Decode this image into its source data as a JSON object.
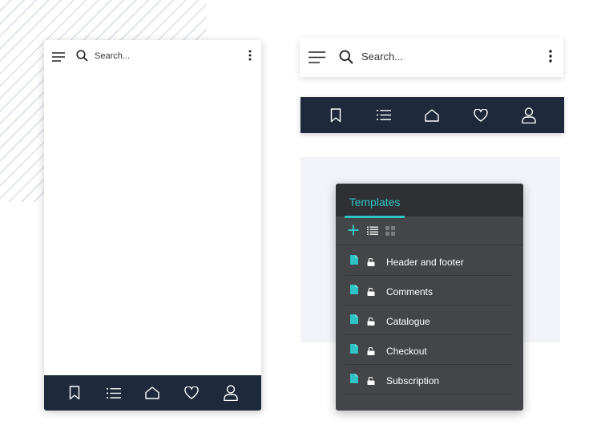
{
  "phone": {
    "search_placeholder": "Search..."
  },
  "searchbar": {
    "search_placeholder": "Search..."
  },
  "nav": {
    "items": [
      {
        "icon": "bookmark-icon"
      },
      {
        "icon": "list-icon"
      },
      {
        "icon": "home-icon"
      },
      {
        "icon": "heart-icon"
      },
      {
        "icon": "user-icon"
      }
    ]
  },
  "templates_panel": {
    "tab_label": "Templates",
    "toolbar": [
      "add-icon",
      "list-view-icon",
      "grid-view-icon"
    ],
    "items": [
      {
        "label": "Header and footer"
      },
      {
        "label": "Comments"
      },
      {
        "label": "Catalogue"
      },
      {
        "label": "Checkout"
      },
      {
        "label": "Subscription"
      }
    ]
  },
  "colors": {
    "nav_background": "#1e2a3c",
    "panel_background": "#444548",
    "panel_header": "#2f3033",
    "accent": "#2ec4c6"
  }
}
